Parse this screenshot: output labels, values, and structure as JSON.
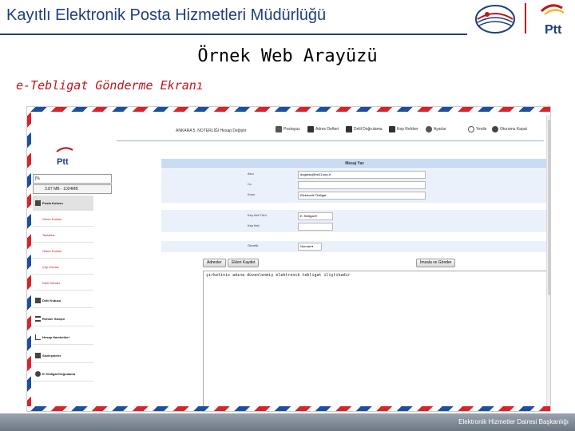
{
  "slide": {
    "title": "Kayıtlı Elektronik Posta Hizmetleri Müdürlüğü",
    "subtitle": "Örnek Web Arayüzü",
    "section": "e-Tebligat Gönderme Ekranı",
    "footer": "Elektronik Hizmetler Dairesi Başkanlığı",
    "logo_text": "Ptt"
  },
  "app": {
    "account_label": "ANKARA 5. NOTERLİĞİ Hesap Değiştir",
    "toolbar": [
      {
        "label": "Postayaz",
        "icon": "pen-icon"
      },
      {
        "label": "Adres Defteri",
        "icon": "address-book-icon"
      },
      {
        "label": "Delil Doğrulama",
        "icon": "document-check-icon"
      },
      {
        "label": "Kep Rehber",
        "icon": "directory-icon"
      },
      {
        "label": "Ayarlar",
        "icon": "gear-icon"
      },
      {
        "label": "Yenile",
        "icon": "refresh-icon"
      },
      {
        "label": "Oturumu Kapat",
        "icon": "logout-icon"
      }
    ],
    "sidebar": {
      "logo_text": "Ptt",
      "search_value": "[%",
      "quota": "3.87 MB - 1024MB",
      "items": [
        {
          "label": "Posta Kutusu",
          "kind": "main",
          "icon": "mailbox-icon"
        },
        {
          "label": "Gelen Kutusu",
          "kind": "sub"
        },
        {
          "label": "Taslaklar",
          "kind": "sub"
        },
        {
          "label": "Giden Kutusu",
          "kind": "sub"
        },
        {
          "label": "Çöp Kutusu",
          "kind": "sub"
        },
        {
          "label": "Delil Gönder",
          "kind": "sub"
        },
        {
          "label": "Delil Kutusu",
          "kind": "main",
          "icon": "inbox-icon"
        },
        {
          "label": "Rehber Sıkıştır",
          "kind": "main",
          "icon": "list-icon"
        },
        {
          "label": "Hesap Hareketleri",
          "kind": "main",
          "icon": "chart-icon"
        },
        {
          "label": "Sözleşmeler",
          "kind": "main",
          "icon": "contract-icon"
        },
        {
          "label": "E-Tebligat Doğrulama",
          "kind": "main",
          "icon": "seal-icon"
        }
      ]
    },
    "compose": {
      "title": "Mesaj Yaz",
      "to_label": "Alıcı",
      "to_value": "dogaras@hs01.kep.tr",
      "cc_label": "Cc",
      "cc_value": "",
      "subject_label": "Konu",
      "subject_value": "Elektronik Tebligat",
      "kep_type_label": "Kep Ileti Türü",
      "kep_type_value": "E-Tebligat",
      "kep_no_label": "Kep Ileti",
      "kep_no_value": "",
      "priority_label": "Öncelik",
      "priority_value": "Normal",
      "buttons": {
        "addresses": "Adresler",
        "attach": "Ekleri Kaydet",
        "sign_send": "İmzala ve Gönder"
      },
      "body": "şirketiniz adına düzenlenmiş elektronik tebligat iliştikadir"
    }
  }
}
